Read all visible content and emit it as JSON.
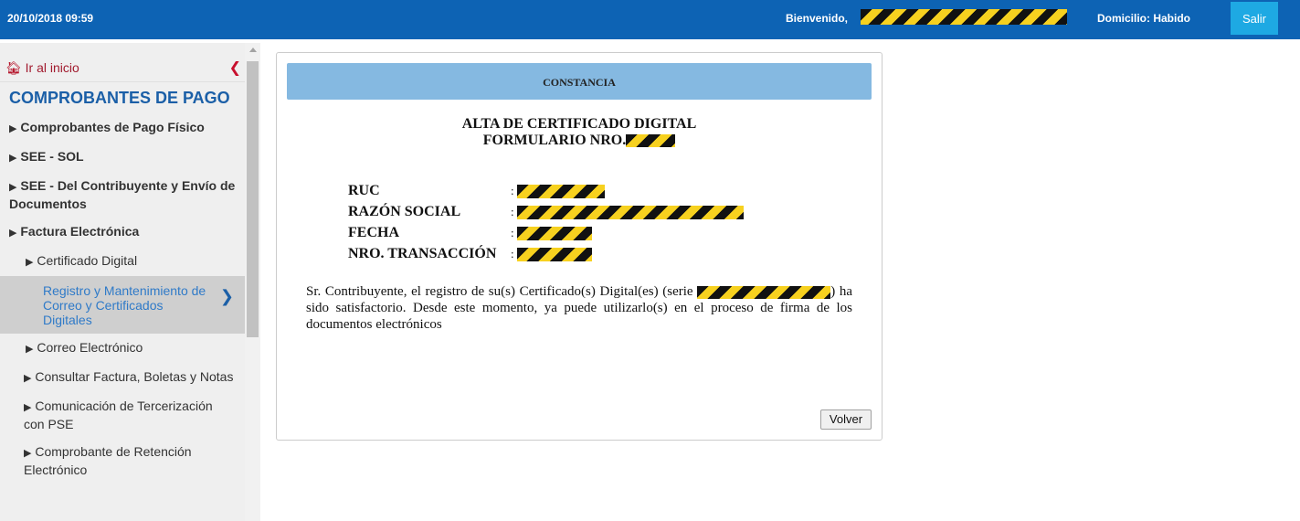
{
  "header": {
    "datetime": "20/10/2018 09:59",
    "welcome_label": "Bienvenido,",
    "domicilio": "Domicilio: Habido",
    "logout_label": "Salir",
    "colors": {
      "bar": "#0d63b4",
      "logout": "#1ea9e3"
    }
  },
  "sidebar": {
    "home_label": "Ir al inicio",
    "home_icon": "home-icon",
    "collapse_icon": "chevron-left-icon",
    "section_title": "COMPROBANTES DE PAGO",
    "items": [
      {
        "label": "Comprobantes de Pago Físico"
      },
      {
        "label": "SEE - SOL"
      },
      {
        "label": "SEE - Del Contribuyente y Envío de Documentos"
      },
      {
        "label": "Factura Electrónica"
      },
      {
        "label": "Certificado Digital"
      },
      {
        "label": "Registro y Mantenimiento de Correo y Certificados Digitales"
      },
      {
        "label": "Correo Electrónico"
      },
      {
        "label": "Consultar Factura, Boletas y Notas"
      },
      {
        "label": "Comunicación de Tercerización con PSE"
      },
      {
        "label": "Comprobante de Retención Electrónico"
      }
    ]
  },
  "constancia": {
    "header": "CONSTANCIA",
    "title_line1": "ALTA DE CERTIFICADO DIGITAL",
    "title_line2": "FORMULARIO NRO.",
    "fields": [
      {
        "label": "RUC"
      },
      {
        "label": "RAZÓN SOCIAL"
      },
      {
        "label": "FECHA"
      },
      {
        "label": "NRO. TRANSACCIÓN"
      }
    ],
    "colon": ":",
    "message_part1": "Sr. Contribuyente, el registro de su(s) Certificado(s) Digital(es) (serie",
    "message_part2": ") ha sido satisfactorio. Desde este momento, ya puede utilizarlo(s) en el proceso de firma de los documentos electrónicos",
    "back_label": "Volver"
  }
}
